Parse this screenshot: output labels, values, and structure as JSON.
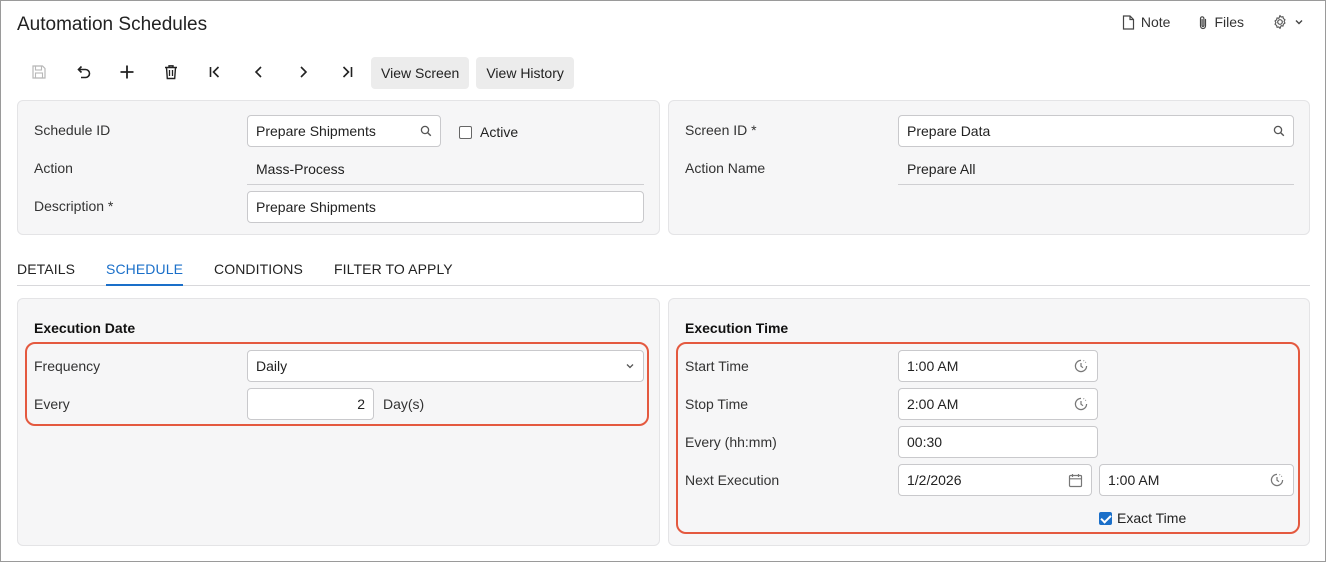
{
  "app": {
    "title": "Automation Schedules"
  },
  "top_actions": {
    "note": "Note",
    "files": "Files"
  },
  "toolbar": {
    "view_screen": "View Screen",
    "view_history": "View History"
  },
  "summary": {
    "left": {
      "schedule_id_label": "Schedule ID",
      "schedule_id_value": "Prepare Shipments",
      "active_label": "Active",
      "active_checked": false,
      "action_label": "Action",
      "action_value": "Mass-Process",
      "description_label": "Description",
      "description_value": "Prepare Shipments",
      "required_mark": "*"
    },
    "right": {
      "screen_id_label": "Screen ID",
      "screen_id_value": "Prepare Data",
      "action_name_label": "Action Name",
      "action_name_value": "Prepare All",
      "required_mark": "*"
    }
  },
  "tabs": [
    "DETAILS",
    "SCHEDULE",
    "CONDITIONS",
    "FILTER TO APPLY"
  ],
  "active_tab": "SCHEDULE",
  "execution_date": {
    "title": "Execution Date",
    "frequency_label": "Frequency",
    "frequency_value": "Daily",
    "every_label": "Every",
    "every_value": "2",
    "every_unit": "Day(s)"
  },
  "execution_time": {
    "title": "Execution Time",
    "start_time_label": "Start Time",
    "start_time_value": "1:00 AM",
    "stop_time_label": "Stop Time",
    "stop_time_value": "2:00 AM",
    "every_label": "Every (hh:mm)",
    "every_value": "00:30",
    "next_execution_label": "Next Execution",
    "next_execution_date": "1/2/2026",
    "next_execution_time": "1:00 AM",
    "exact_time_label": "Exact Time",
    "exact_time_checked": true
  },
  "colors": {
    "accent": "#1a6fc9",
    "highlight": "#e4593f",
    "panel_bg": "#f6f6f7"
  }
}
